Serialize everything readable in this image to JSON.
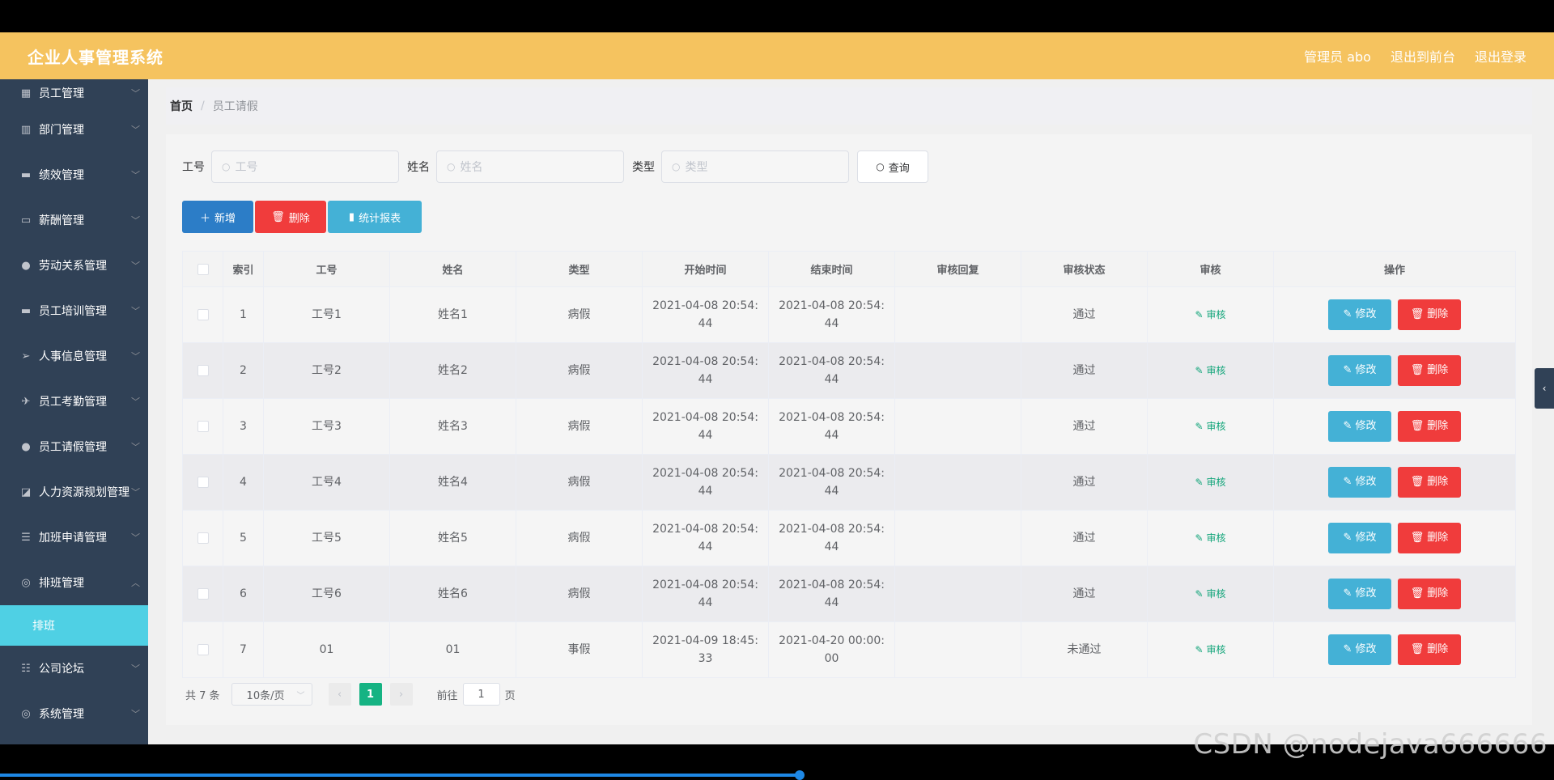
{
  "header": {
    "title": "企业人事管理系统",
    "user": "管理员 abo",
    "to_front": "退出到前台",
    "logout": "退出登录"
  },
  "sidebar": {
    "items": [
      {
        "label": "员工管理",
        "icon": "grid-icon"
      },
      {
        "label": "部门管理",
        "icon": "building-icon"
      },
      {
        "label": "绩效管理",
        "icon": "monitor-icon"
      },
      {
        "label": "薪酬管理",
        "icon": "card-icon"
      },
      {
        "label": "劳动关系管理",
        "icon": "user-icon"
      },
      {
        "label": "员工培训管理",
        "icon": "monitor-icon"
      },
      {
        "label": "人事信息管理",
        "icon": "send-icon"
      },
      {
        "label": "员工考勤管理",
        "icon": "paper-plane-icon"
      },
      {
        "label": "员工请假管理",
        "icon": "user-icon"
      },
      {
        "label": "人力资源规划管理",
        "icon": "chart-icon"
      },
      {
        "label": "加班申请管理",
        "icon": "list-icon"
      },
      {
        "label": "排班管理",
        "icon": "compass-icon"
      },
      {
        "label": "公司论坛",
        "icon": "sliders-icon"
      },
      {
        "label": "系统管理",
        "icon": "compass-icon"
      }
    ],
    "sub_item": "排班"
  },
  "breadcrumb": {
    "home": "首页",
    "sep": "/",
    "current": "员工请假"
  },
  "search": {
    "f1_label": "工号",
    "f1_placeholder": "工号",
    "f2_label": "姓名",
    "f2_placeholder": "姓名",
    "f3_label": "类型",
    "f3_placeholder": "类型",
    "query": "查询"
  },
  "actions": {
    "add": "新增",
    "delete": "删除",
    "report": "统计报表"
  },
  "table": {
    "headers": [
      "索引",
      "工号",
      "姓名",
      "类型",
      "开始时间",
      "结束时间",
      "审核回复",
      "审核状态",
      "审核",
      "操作"
    ],
    "rows": [
      {
        "idx": "1",
        "no": "工号1",
        "name": "姓名1",
        "type": "病假",
        "start": "2021-04-08 20:54:44",
        "end": "2021-04-08 20:54:44",
        "reply": "",
        "status": "通过"
      },
      {
        "idx": "2",
        "no": "工号2",
        "name": "姓名2",
        "type": "病假",
        "start": "2021-04-08 20:54:44",
        "end": "2021-04-08 20:54:44",
        "reply": "",
        "status": "通过"
      },
      {
        "idx": "3",
        "no": "工号3",
        "name": "姓名3",
        "type": "病假",
        "start": "2021-04-08 20:54:44",
        "end": "2021-04-08 20:54:44",
        "reply": "",
        "status": "通过"
      },
      {
        "idx": "4",
        "no": "工号4",
        "name": "姓名4",
        "type": "病假",
        "start": "2021-04-08 20:54:44",
        "end": "2021-04-08 20:54:44",
        "reply": "",
        "status": "通过"
      },
      {
        "idx": "5",
        "no": "工号5",
        "name": "姓名5",
        "type": "病假",
        "start": "2021-04-08 20:54:44",
        "end": "2021-04-08 20:54:44",
        "reply": "",
        "status": "通过"
      },
      {
        "idx": "6",
        "no": "工号6",
        "name": "姓名6",
        "type": "病假",
        "start": "2021-04-08 20:54:44",
        "end": "2021-04-08 20:54:44",
        "reply": "",
        "status": "通过"
      },
      {
        "idx": "7",
        "no": "01",
        "name": "01",
        "type": "事假",
        "start": "2021-04-09 18:45:33",
        "end": "2021-04-20 00:00:00",
        "reply": "",
        "status": "未通过"
      }
    ],
    "audit_label": "审核",
    "edit_label": "修改",
    "delete_label": "删除"
  },
  "pager": {
    "total": "共 7 条",
    "page_size": "10条/页",
    "current": "1",
    "goto_pre": "前往",
    "goto_value": "1",
    "goto_post": "页"
  },
  "watermark": "CSDN @nodejava666666",
  "colors": {
    "header": "#f5c35f",
    "sidebar": "#304156",
    "active_sub": "#4fd0e4",
    "primary": "#2c7dc7",
    "danger": "#f03c3c",
    "info": "#44b1d6",
    "success": "#16b383"
  }
}
